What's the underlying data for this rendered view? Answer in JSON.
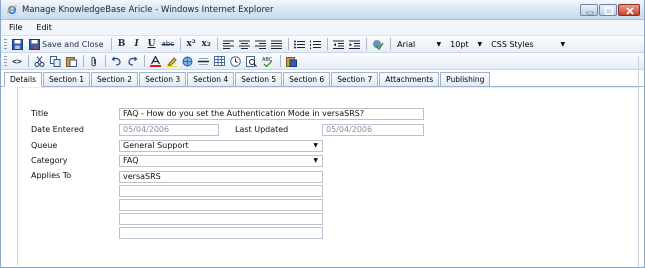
{
  "window": {
    "title": "Manage KnowledgeBase Aricle - Windows Internet Explorer"
  },
  "menu": {
    "items": [
      "File",
      "Edit"
    ]
  },
  "toolbar1": {
    "save_close_label": "Save and Close",
    "bold": "B",
    "italic": "I",
    "underline": "U",
    "strike": "abc",
    "superscript": "x²",
    "subscript": "x₂",
    "font_value": "Arial",
    "size_value": "10pt",
    "css_value": "CSS Styles"
  },
  "toolbar2": {
    "source_label": "<>"
  },
  "tabs": [
    {
      "label": "Details",
      "active": true
    },
    {
      "label": "Section 1"
    },
    {
      "label": "Section 2"
    },
    {
      "label": "Section 3"
    },
    {
      "label": "Section 4"
    },
    {
      "label": "Section 5"
    },
    {
      "label": "Section 6"
    },
    {
      "label": "Section 7"
    },
    {
      "label": "Attachments"
    },
    {
      "label": "Publishing"
    }
  ],
  "form": {
    "title_label": "Title",
    "title_value": "FAQ - How do you set the Authentication Mode in versaSRS?",
    "date_entered_label": "Date Entered",
    "date_entered_value": "05/04/2006",
    "last_updated_label": "Last Updated",
    "last_updated_value": "05/04/2006",
    "queue_label": "Queue",
    "queue_value": "General Support",
    "category_label": "Category",
    "category_value": "FAQ",
    "applies_to_label": "Applies To",
    "applies_to_values": [
      "versaSRS",
      "",
      "",
      "",
      "",
      ""
    ]
  }
}
